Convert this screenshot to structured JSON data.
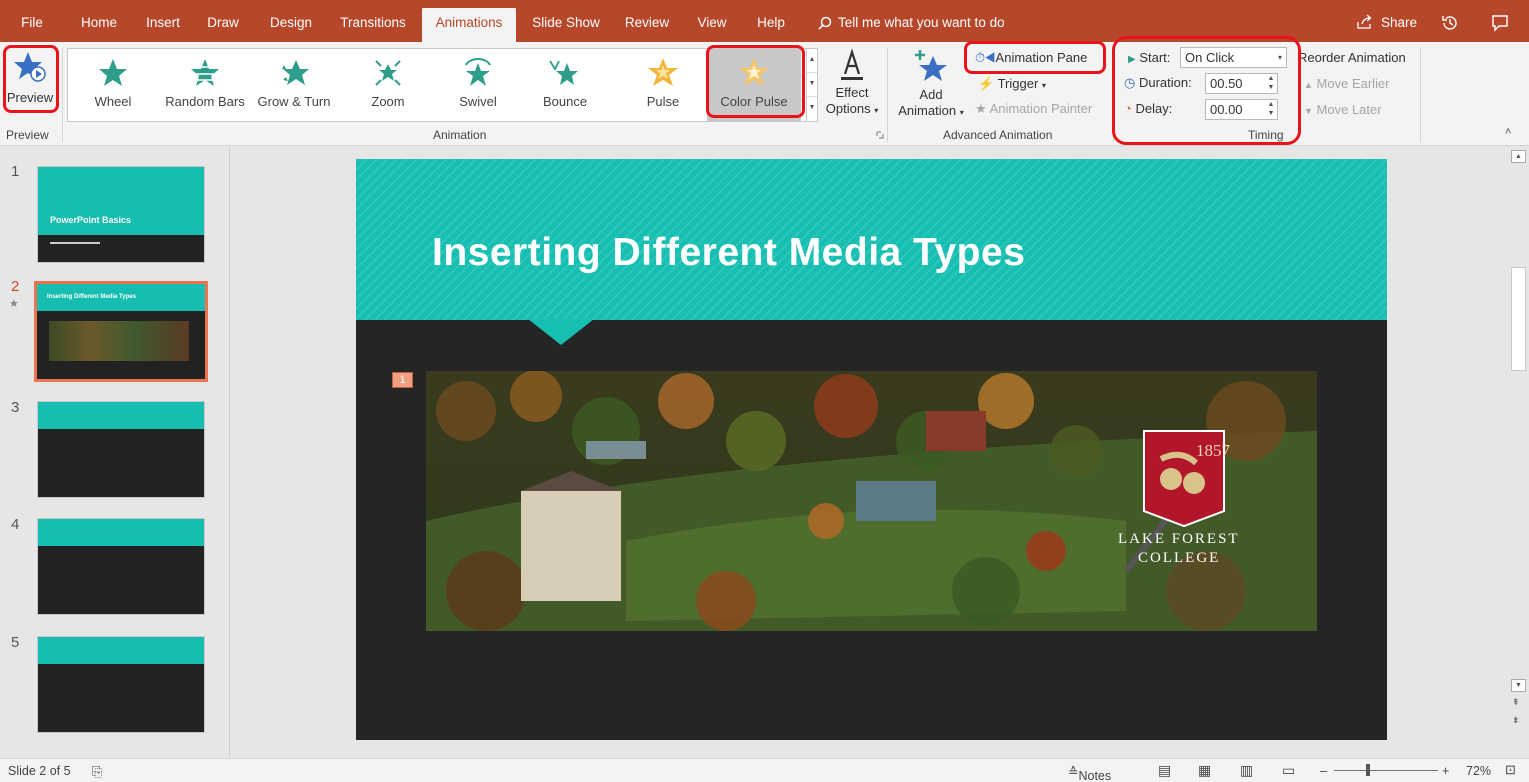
{
  "tabs": [
    "File",
    "Home",
    "Insert",
    "Draw",
    "Design",
    "Transitions",
    "Animations",
    "Slide Show",
    "Review",
    "View",
    "Help"
  ],
  "active_tab": "Animations",
  "tell_me": "Tell me what you want to do",
  "share_label": "Share",
  "ribbon": {
    "preview": {
      "button": "Preview",
      "group": "Preview"
    },
    "animation": {
      "group": "Animation",
      "items": [
        "Wheel",
        "Random Bars",
        "Grow & Turn",
        "Zoom",
        "Swivel",
        "Bounce",
        "Pulse",
        "Color Pulse"
      ],
      "selected": "Color Pulse",
      "effect_options_line1": "Effect",
      "effect_options_line2": "Options"
    },
    "advanced": {
      "group": "Advanced Animation",
      "add_animation_line1": "Add",
      "add_animation_line2": "Animation",
      "animation_pane": "Animation Pane",
      "trigger": "Trigger",
      "animation_painter": "Animation Painter"
    },
    "timing": {
      "group": "Timing",
      "start_label": "Start:",
      "start_value": "On Click",
      "duration_label": "Duration:",
      "duration_value": "00.50",
      "delay_label": "Delay:",
      "delay_value": "00.00",
      "reorder": "Reorder Animation",
      "move_earlier": "Move Earlier",
      "move_later": "Move Later"
    }
  },
  "thumbnails": [
    {
      "num": "1",
      "title": "PowerPoint Basics"
    },
    {
      "num": "2",
      "title": "Inserting Different Media Types"
    },
    {
      "num": "3"
    },
    {
      "num": "4"
    },
    {
      "num": "5"
    }
  ],
  "slide": {
    "title": "Inserting Different Media Types",
    "animation_tag": "1",
    "logo_year": "1857",
    "logo_line1": "LAKE FOREST",
    "logo_line2": "COLLEGE"
  },
  "status": {
    "slide_info": "Slide 2 of 5",
    "notes": "Notes",
    "zoom": "72%"
  },
  "colors": {
    "accent": "#b7472a",
    "teal": "#16bfb1",
    "highlight": "#e8141c"
  }
}
